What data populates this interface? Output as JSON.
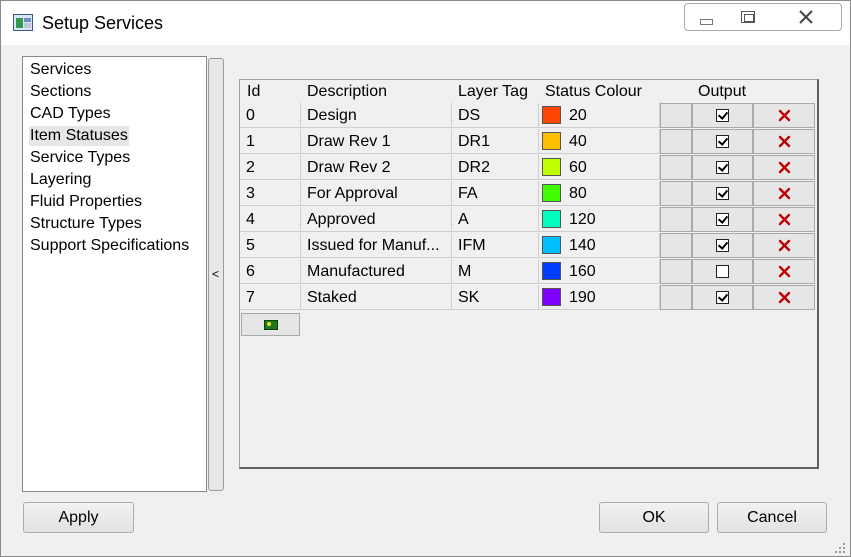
{
  "window": {
    "title": "Setup Services",
    "controls": [
      "minimize-icon",
      "maximize-icon",
      "close-icon"
    ]
  },
  "nav": {
    "items": [
      {
        "label": "Services",
        "selected": false
      },
      {
        "label": "Sections",
        "selected": false
      },
      {
        "label": "CAD Types",
        "selected": false
      },
      {
        "label": "Item Statuses",
        "selected": true
      },
      {
        "label": "Service Types",
        "selected": false
      },
      {
        "label": "Layering",
        "selected": false
      },
      {
        "label": "Fluid Properties",
        "selected": false
      },
      {
        "label": "Structure Types",
        "selected": false
      },
      {
        "label": "Support Specifications",
        "selected": false
      }
    ],
    "collapse_glyph": "<"
  },
  "grid": {
    "headers": {
      "id": "Id",
      "description": "Description",
      "layer_tag": "Layer Tag",
      "status_colour": "Status Colour",
      "output": "Output"
    },
    "rows": [
      {
        "id": "0",
        "description": "Design",
        "layer_tag": "DS",
        "colour": "#ff4500",
        "colour_value": "20",
        "output": true
      },
      {
        "id": "1",
        "description": "Draw Rev 1",
        "layer_tag": "DR1",
        "colour": "#ffbf00",
        "colour_value": "40",
        "output": true
      },
      {
        "id": "2",
        "description": "Draw Rev 2",
        "layer_tag": "DR2",
        "colour": "#bfff00",
        "colour_value": "60",
        "output": true
      },
      {
        "id": "3",
        "description": "For Approval",
        "layer_tag": "FA",
        "colour": "#3fff00",
        "colour_value": "80",
        "output": true
      },
      {
        "id": "4",
        "description": "Approved",
        "layer_tag": "A",
        "colour": "#00ffbf",
        "colour_value": "120",
        "output": true
      },
      {
        "id": "5",
        "description": "Issued for Manuf...",
        "layer_tag": "IFM",
        "colour": "#00bfff",
        "colour_value": "140",
        "output": true
      },
      {
        "id": "6",
        "description": "Manufactured",
        "layer_tag": "M",
        "colour": "#003fff",
        "colour_value": "160",
        "output": false
      },
      {
        "id": "7",
        "description": "Staked",
        "layer_tag": "SK",
        "colour": "#7f00ff",
        "colour_value": "190",
        "output": true
      }
    ],
    "delete_icon": "red-x-icon",
    "add_row_icon": "add-row-icon"
  },
  "buttons": {
    "apply": "Apply",
    "ok": "OK",
    "cancel": "Cancel"
  }
}
